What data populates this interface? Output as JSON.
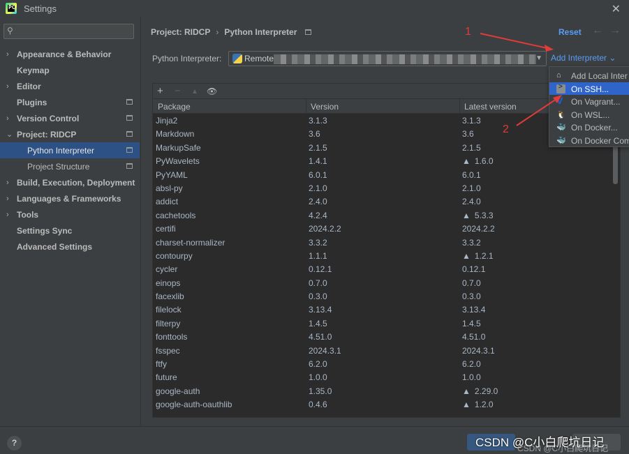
{
  "window": {
    "title": "Settings",
    "close": "✕"
  },
  "search": {
    "placeholder": "",
    "icon": "search-icon"
  },
  "sidebar": {
    "items": [
      {
        "label": "Appearance & Behavior",
        "chevron": "›"
      },
      {
        "label": "Keymap",
        "chevron": ""
      },
      {
        "label": "Editor",
        "chevron": "›"
      },
      {
        "label": "Plugins",
        "chevron": ""
      },
      {
        "label": "Version Control",
        "chevron": "›"
      },
      {
        "label": "Project: RIDCP",
        "chevron": "⌄"
      },
      {
        "label": "Python Interpreter",
        "chevron": ""
      },
      {
        "label": "Project Structure",
        "chevron": ""
      },
      {
        "label": "Build, Execution, Deployment",
        "chevron": "›"
      },
      {
        "label": "Languages & Frameworks",
        "chevron": "›"
      },
      {
        "label": "Tools",
        "chevron": "›"
      },
      {
        "label": "Settings Sync",
        "chevron": ""
      },
      {
        "label": "Advanced Settings",
        "chevron": ""
      }
    ]
  },
  "header": {
    "crumb1": "Project: RIDCP",
    "sep": "›",
    "crumb2": "Python Interpreter",
    "reset": "Reset",
    "back": "←",
    "forward": "→"
  },
  "interpreter": {
    "label": "Python Interpreter:",
    "value": "Remote",
    "dropdown_arrow": "▼",
    "add": "Add Interpreter ⌄"
  },
  "toolbar": {
    "add": "+",
    "remove": "−",
    "upgrade": "▲",
    "show": "👁"
  },
  "table": {
    "headers": [
      "Package",
      "Version",
      "Latest version"
    ],
    "rows": [
      [
        "Jinja2",
        "3.1.3",
        "3.1.3",
        false
      ],
      [
        "Markdown",
        "3.6",
        "3.6",
        false
      ],
      [
        "MarkupSafe",
        "2.1.5",
        "2.1.5",
        false
      ],
      [
        "PyWavelets",
        "1.4.1",
        "1.6.0",
        true
      ],
      [
        "PyYAML",
        "6.0.1",
        "6.0.1",
        false
      ],
      [
        "absl-py",
        "2.1.0",
        "2.1.0",
        false
      ],
      [
        "addict",
        "2.4.0",
        "2.4.0",
        false
      ],
      [
        "cachetools",
        "4.2.4",
        "5.3.3",
        true
      ],
      [
        "certifi",
        "2024.2.2",
        "2024.2.2",
        false
      ],
      [
        "charset-normalizer",
        "3.3.2",
        "3.3.2",
        false
      ],
      [
        "contourpy",
        "1.1.1",
        "1.2.1",
        true
      ],
      [
        "cycler",
        "0.12.1",
        "0.12.1",
        false
      ],
      [
        "einops",
        "0.7.0",
        "0.7.0",
        false
      ],
      [
        "facexlib",
        "0.3.0",
        "0.3.0",
        false
      ],
      [
        "filelock",
        "3.13.4",
        "3.13.4",
        false
      ],
      [
        "filterpy",
        "1.4.5",
        "1.4.5",
        false
      ],
      [
        "fonttools",
        "4.51.0",
        "4.51.0",
        false
      ],
      [
        "fsspec",
        "2024.3.1",
        "2024.3.1",
        false
      ],
      [
        "ftfy",
        "6.2.0",
        "6.2.0",
        false
      ],
      [
        "future",
        "1.0.0",
        "1.0.0",
        false
      ],
      [
        "google-auth",
        "1.35.0",
        "2.29.0",
        true
      ],
      [
        "google-auth-oauthlib",
        "0.4.6",
        "1.2.0",
        true
      ]
    ]
  },
  "menu": {
    "items": [
      {
        "label": "Add Local Inter",
        "icon": "home-icon"
      },
      {
        "label": "On SSH...",
        "icon": "terminal-icon"
      },
      {
        "label": "On Vagrant...",
        "icon": "vagrant-icon"
      },
      {
        "label": "On WSL...",
        "icon": "linux-icon"
      },
      {
        "label": "On Docker...",
        "icon": "docker-icon"
      },
      {
        "label": "On Docker Com",
        "icon": "docker-icon"
      }
    ]
  },
  "annotations": {
    "one": "1",
    "two": "2",
    "color": "#e23b3b"
  },
  "footer": {
    "help": "?",
    "watermark": "CSDN @C小白爬坑日记",
    "watermark_sub": "CSDN @C小白爬坑日记"
  },
  "colors": {
    "accent": "#589df6",
    "selection": "#2d5185",
    "highlight": "#2f65ca"
  }
}
